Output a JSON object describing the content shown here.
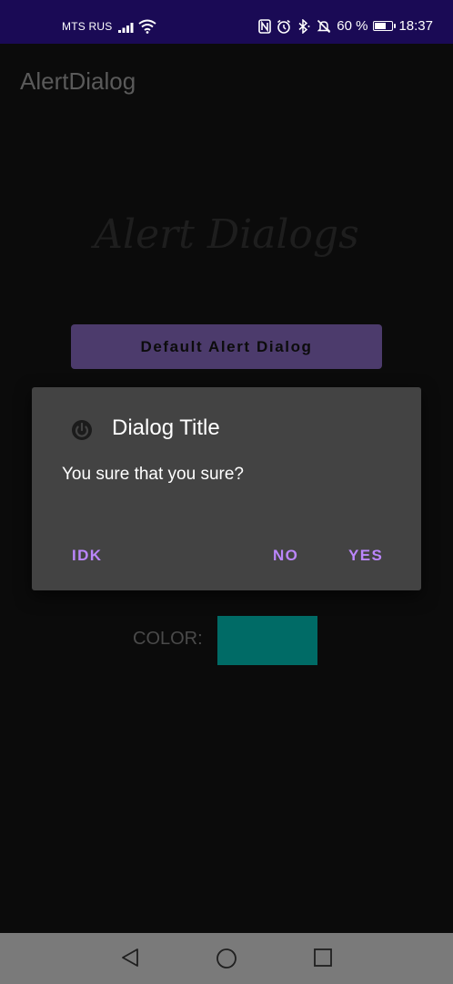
{
  "status_bar": {
    "carrier": "MTS RUS",
    "battery_text": "60 %",
    "time": "18:37",
    "icons": [
      "signal-icon",
      "wifi-icon",
      "nfc-icon",
      "alarm-icon",
      "bluetooth-icon",
      "mute-icon",
      "battery-icon"
    ]
  },
  "app": {
    "title": "AlertDialog",
    "hero": "Alert Dialogs",
    "default_button": "Default Alert Dialog",
    "color_label": "COLOR:",
    "color_value": "#006b66"
  },
  "dialog": {
    "title": "Dialog Title",
    "message": "You sure that you sure?",
    "icon": "power-icon",
    "buttons": {
      "neutral": "IDK",
      "negative": "NO",
      "positive": "YES"
    },
    "button_color": "#bb86fc"
  },
  "nav_bar": {
    "icons": [
      "back-icon",
      "home-icon",
      "recents-icon"
    ]
  }
}
